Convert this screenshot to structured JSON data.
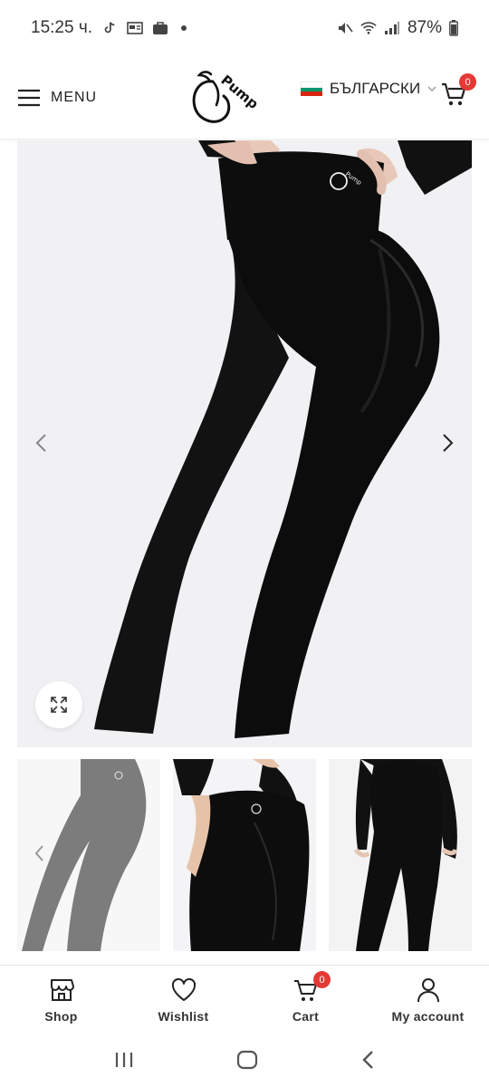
{
  "status_bar": {
    "time": "15:25 ч.",
    "battery": "87%"
  },
  "header": {
    "menu_label": "MENU",
    "logo_text": "Pump",
    "language": "БЪЛГАРСКИ",
    "cart_count": "0"
  },
  "colors": {
    "accent": "#e53935",
    "flag_white": "#ffffff",
    "flag_green": "#00966e",
    "flag_red": "#d62612",
    "product": "#111111",
    "image_bg": "#f1f0f3"
  },
  "product_image": {
    "prev_icon": "chevron-left-icon",
    "next_icon": "chevron-right-icon",
    "zoom_icon": "expand-icon"
  },
  "bottom_nav": {
    "items": [
      {
        "label": "Shop",
        "icon": "store-icon"
      },
      {
        "label": "Wishlist",
        "icon": "heart-icon"
      },
      {
        "label": "Cart",
        "icon": "cart-icon",
        "badge": "0"
      },
      {
        "label": "My account",
        "icon": "user-icon"
      }
    ]
  }
}
